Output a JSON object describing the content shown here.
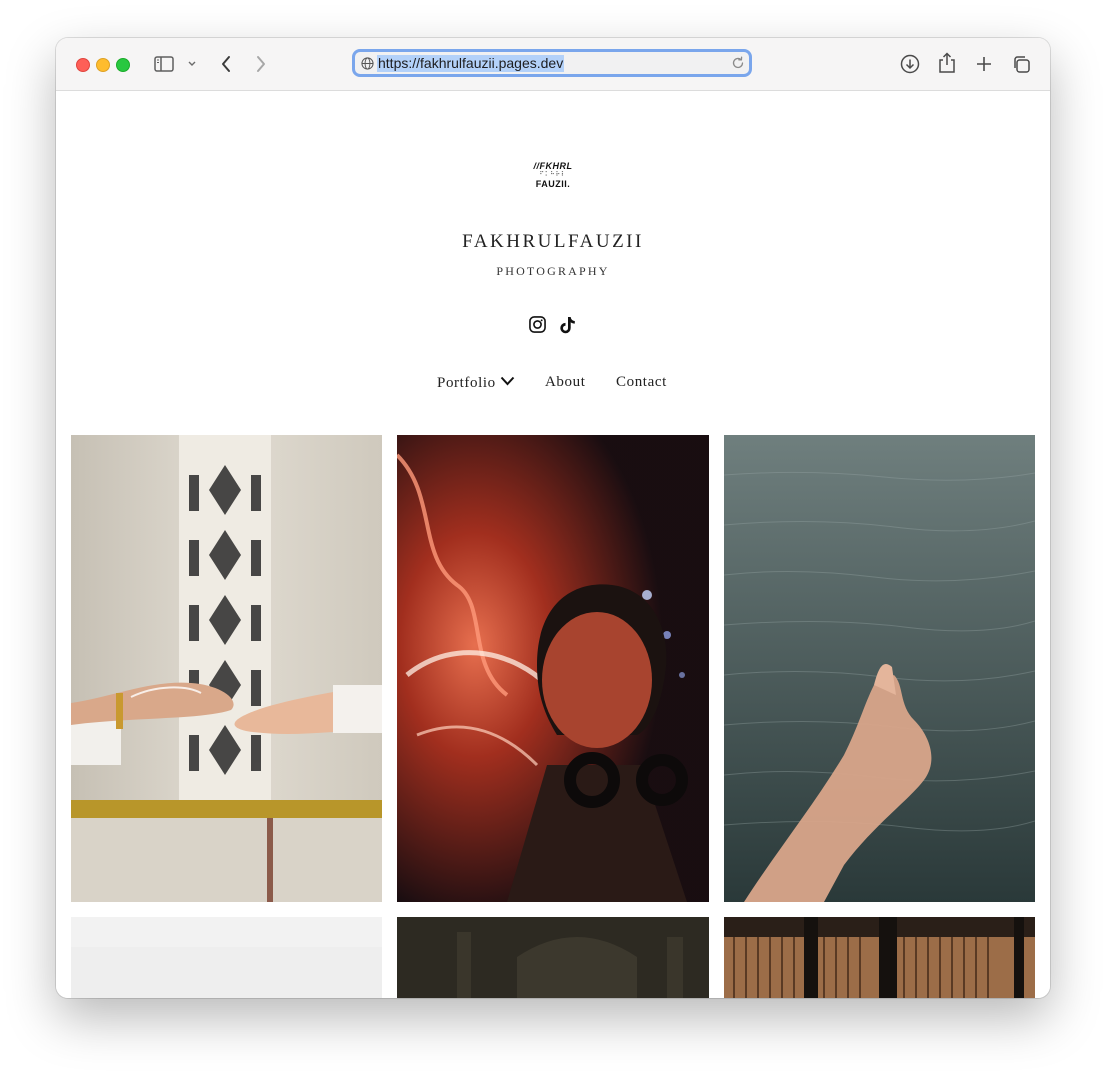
{
  "browser": {
    "url": "https://fakhrulfauzii.pages.dev"
  },
  "logo": {
    "line1": "//FKHRL",
    "line2": "⠋⠅⠓⠗⠇",
    "line3": "FAUZII."
  },
  "site": {
    "title": "FAKHRULFAUZII",
    "subtitle": "PHOTOGRAPHY"
  },
  "social": [
    "instagram-icon",
    "tiktok-icon"
  ],
  "nav": {
    "portfolio": "Portfolio",
    "about": "About",
    "contact": "Contact"
  },
  "gallery": [
    "henna-hands-photo",
    "neon-portrait-photo",
    "hand-over-water-photo",
    "white-wall-photo",
    "dark-building-photo",
    "window-blinds-photo"
  ]
}
